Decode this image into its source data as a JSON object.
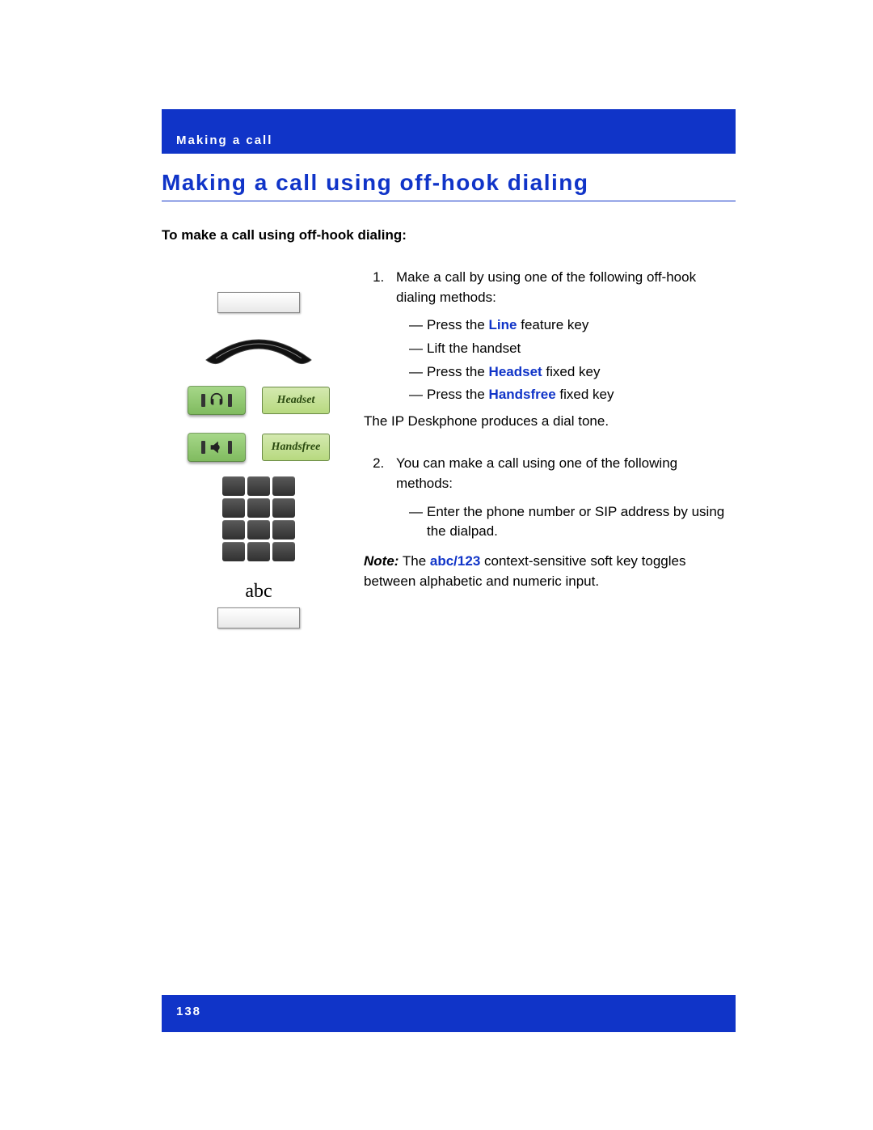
{
  "header": {
    "section": "Making a call"
  },
  "title": "Making a call using off-hook dialing",
  "intro": "To make a call using off-hook dialing:",
  "illus": {
    "headset_tag": "Headset",
    "handsfree_tag": "Handsfree",
    "abc_label": "abc"
  },
  "steps": {
    "s1": {
      "lead": "Make a call by using one of the following off-hook dialing methods:",
      "opt1_pre": "Press the ",
      "opt1_kw": "Line",
      "opt1_post": " feature key",
      "opt2": "Lift the handset",
      "opt3_pre": "Press the ",
      "opt3_kw": "Headset",
      "opt3_post": " fixed key",
      "opt4_pre": "Press the ",
      "opt4_kw": "Handsfree",
      "opt4_post": " fixed key",
      "result": "The IP Deskphone produces a dial tone."
    },
    "s2": {
      "lead": "You can make a call using one of the following methods:",
      "opt1": "Enter the phone number or SIP address by using the dialpad.",
      "note_label": "Note:",
      "note_pre": "  The ",
      "note_kw": "abc/123",
      "note_post": " context-sensitive soft key toggles between alphabetic and numeric input."
    }
  },
  "footer": {
    "page_number": "138"
  }
}
